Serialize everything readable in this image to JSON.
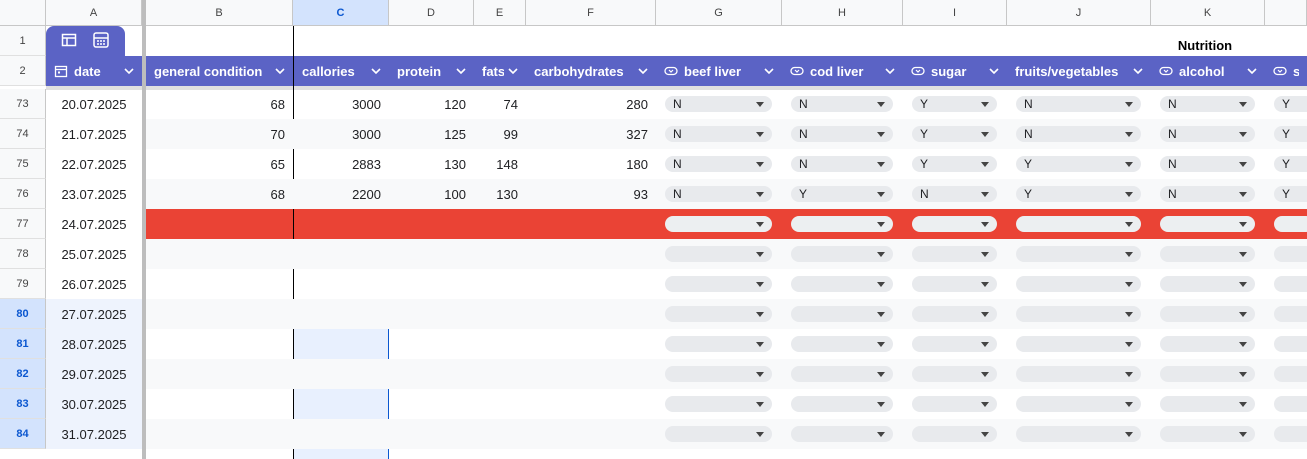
{
  "column_letters": [
    "A",
    "B",
    "C",
    "D",
    "E",
    "F",
    "G",
    "H",
    "I",
    "J",
    "K"
  ],
  "row_numbers_top": [
    "1",
    "2"
  ],
  "section_header": "Nutrition",
  "headers": {
    "date": "date",
    "general_condition": "general condition",
    "callories": "callories",
    "protein": "protein",
    "fats": "fats",
    "carbohydrates": "carbohydrates",
    "beef_liver": "beef liver",
    "cod_liver": "cod liver",
    "sugar": "sugar",
    "fruits_vegetables": "fruits/vegetables",
    "alcohol": "alcohol",
    "partial": "s"
  },
  "rows": [
    {
      "num": "73",
      "date": "20.07.2025",
      "condition": "68",
      "callories": "3000",
      "protein": "120",
      "fats": "74",
      "carbs": "280",
      "beef": "N",
      "cod": "N",
      "sugar": "Y",
      "fruits": "N",
      "alcohol": "N",
      "s": "Y"
    },
    {
      "num": "74",
      "date": "21.07.2025",
      "condition": "70",
      "callories": "3000",
      "protein": "125",
      "fats": "99",
      "carbs": "327",
      "beef": "N",
      "cod": "N",
      "sugar": "Y",
      "fruits": "N",
      "alcohol": "N",
      "s": "Y"
    },
    {
      "num": "75",
      "date": "22.07.2025",
      "condition": "65",
      "callories": "2883",
      "protein": "130",
      "fats": "148",
      "carbs": "180",
      "beef": "N",
      "cod": "N",
      "sugar": "Y",
      "fruits": "Y",
      "alcohol": "N",
      "s": "Y"
    },
    {
      "num": "76",
      "date": "23.07.2025",
      "condition": "68",
      "callories": "2200",
      "protein": "100",
      "fats": "130",
      "carbs": "93",
      "beef": "N",
      "cod": "Y",
      "sugar": "N",
      "fruits": "Y",
      "alcohol": "N",
      "s": "Y"
    },
    {
      "num": "77",
      "date": "24.07.2025",
      "condition": "",
      "callories": "",
      "protein": "",
      "fats": "",
      "carbs": "",
      "beef": "",
      "cod": "",
      "sugar": "",
      "fruits": "",
      "alcohol": "",
      "s": ""
    },
    {
      "num": "78",
      "date": "25.07.2025",
      "condition": "",
      "callories": "",
      "protein": "",
      "fats": "",
      "carbs": "",
      "beef": "",
      "cod": "",
      "sugar": "",
      "fruits": "",
      "alcohol": "",
      "s": ""
    },
    {
      "num": "79",
      "date": "26.07.2025",
      "condition": "",
      "callories": "",
      "protein": "",
      "fats": "",
      "carbs": "",
      "beef": "",
      "cod": "",
      "sugar": "",
      "fruits": "",
      "alcohol": "",
      "s": ""
    },
    {
      "num": "80",
      "date": "27.07.2025",
      "condition": "",
      "callories": "",
      "protein": "",
      "fats": "",
      "carbs": "",
      "beef": "",
      "cod": "",
      "sugar": "",
      "fruits": "",
      "alcohol": "",
      "s": ""
    },
    {
      "num": "81",
      "date": "28.07.2025",
      "condition": "",
      "callories": "",
      "protein": "",
      "fats": "",
      "carbs": "",
      "beef": "",
      "cod": "",
      "sugar": "",
      "fruits": "",
      "alcohol": "",
      "s": ""
    },
    {
      "num": "82",
      "date": "29.07.2025",
      "condition": "",
      "callories": "",
      "protein": "",
      "fats": "",
      "carbs": "",
      "beef": "",
      "cod": "",
      "sugar": "",
      "fruits": "",
      "alcohol": "",
      "s": ""
    },
    {
      "num": "83",
      "date": "30.07.2025",
      "condition": "",
      "callories": "",
      "protein": "",
      "fats": "",
      "carbs": "",
      "beef": "",
      "cod": "",
      "sugar": "",
      "fruits": "",
      "alcohol": "",
      "s": ""
    },
    {
      "num": "84",
      "date": "31.07.2025",
      "condition": "",
      "callories": "",
      "protein": "",
      "fats": "",
      "carbs": "",
      "beef": "",
      "cod": "",
      "sugar": "",
      "fruits": "",
      "alcohol": "",
      "s": ""
    }
  ],
  "selected_rows": [
    "80",
    "81",
    "82",
    "83",
    "84"
  ],
  "selected_column": "C",
  "highlighted_row": "77",
  "colors": {
    "header": "#5b63c5",
    "highlight": "#ea4335",
    "selection": "#1a73e8"
  },
  "icons": {
    "table_view": "table-icon",
    "calculator": "calculator-icon",
    "calendar": "calendar-icon",
    "dropdown_chip": "chip-icon"
  }
}
